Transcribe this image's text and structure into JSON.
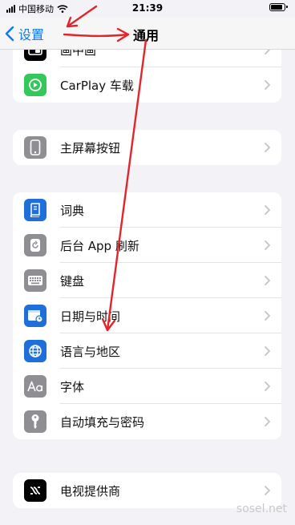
{
  "status_bar": {
    "carrier": "中国移动",
    "time": "21:39"
  },
  "nav": {
    "back_label": "设置",
    "title": "通用"
  },
  "groups": [
    {
      "items": [
        {
          "label": "画中画",
          "icon": "picture-in-picture-icon",
          "color": "#000000"
        },
        {
          "label": "CarPlay 车载",
          "icon": "carplay-icon",
          "color": "#34c759"
        }
      ]
    },
    {
      "items": [
        {
          "label": "主屏幕按钮",
          "icon": "home-button-icon",
          "color": "#8e8e93"
        }
      ]
    },
    {
      "items": [
        {
          "label": "词典",
          "icon": "dictionary-icon",
          "color": "#1e6fd9"
        },
        {
          "label": "后台 App 刷新",
          "icon": "background-refresh-icon",
          "color": "#8e8e93"
        },
        {
          "label": "键盘",
          "icon": "keyboard-icon",
          "color": "#8e8e93"
        },
        {
          "label": "日期与时间",
          "icon": "calendar-clock-icon",
          "color": "#1e6fd9"
        },
        {
          "label": "语言与地区",
          "icon": "globe-icon",
          "color": "#1e6fd9"
        },
        {
          "label": "字体",
          "icon": "fonts-icon",
          "color": "#8e8e93"
        },
        {
          "label": "自动填充与密码",
          "icon": "key-icon",
          "color": "#8e8e93"
        }
      ]
    },
    {
      "items": [
        {
          "label": "电视提供商",
          "icon": "tv-provider-icon",
          "color": "#000000"
        }
      ]
    }
  ],
  "watermark": "sosel.net",
  "accent": "#0a7aff",
  "annotation_color": "#e3242b"
}
